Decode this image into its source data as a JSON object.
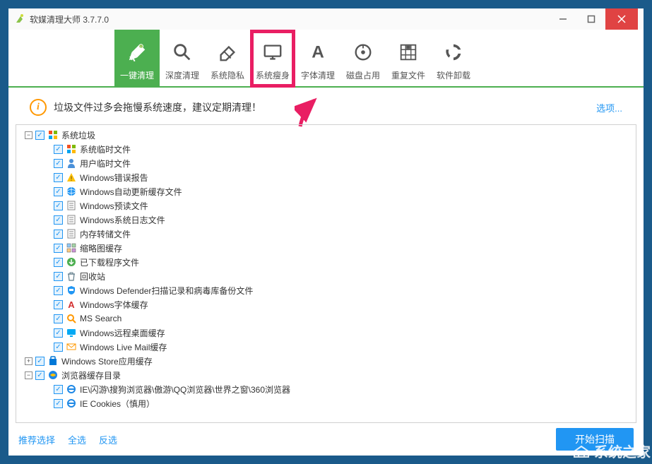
{
  "titlebar": {
    "title": "软媒清理大师 3.7.7.0"
  },
  "toolbar": {
    "items": [
      {
        "label": "一键清理",
        "icon": "brush",
        "active": true
      },
      {
        "label": "深度清理",
        "icon": "search"
      },
      {
        "label": "系统隐私",
        "icon": "eraser"
      },
      {
        "label": "系统瘦身",
        "icon": "monitor",
        "highlighted": true
      },
      {
        "label": "字体清理",
        "icon": "font"
      },
      {
        "label": "磁盘占用",
        "icon": "disk"
      },
      {
        "label": "重复文件",
        "icon": "grid"
      },
      {
        "label": "软件卸载",
        "icon": "recycle"
      }
    ]
  },
  "info": {
    "text": "垃圾文件过多会拖慢系统速度，建议定期清理！",
    "options_label": "选项..."
  },
  "tree": [
    {
      "depth": 0,
      "exp": "-",
      "icon": "win",
      "label": "系统垃圾"
    },
    {
      "depth": 1,
      "icon": "win",
      "label": "系统临时文件"
    },
    {
      "depth": 1,
      "icon": "user",
      "label": "用户临时文件"
    },
    {
      "depth": 1,
      "icon": "warn",
      "label": "Windows错误报告"
    },
    {
      "depth": 1,
      "icon": "globe",
      "label": "Windows自动更新缓存文件"
    },
    {
      "depth": 1,
      "icon": "doc",
      "label": "Windows预读文件"
    },
    {
      "depth": 1,
      "icon": "doc",
      "label": "Windows系统日志文件"
    },
    {
      "depth": 1,
      "icon": "doc",
      "label": "内存转储文件"
    },
    {
      "depth": 1,
      "icon": "thumb",
      "label": "缩略图缓存"
    },
    {
      "depth": 1,
      "icon": "download",
      "label": "已下载程序文件"
    },
    {
      "depth": 1,
      "icon": "bin",
      "label": "回收站"
    },
    {
      "depth": 1,
      "icon": "shield",
      "label": "Windows Defender扫描记录和病毒库备份文件"
    },
    {
      "depth": 1,
      "icon": "font",
      "label": "Windows字体缓存"
    },
    {
      "depth": 1,
      "icon": "search-y",
      "label": "MS Search"
    },
    {
      "depth": 1,
      "icon": "remote",
      "label": "Windows远程桌面缓存"
    },
    {
      "depth": 1,
      "icon": "mail",
      "label": "Windows Live Mail缓存"
    },
    {
      "depth": 0,
      "exp": "+",
      "icon": "store",
      "label": "Windows Store应用缓存"
    },
    {
      "depth": 0,
      "exp": "-",
      "icon": "ie",
      "label": "浏览器缓存目录"
    },
    {
      "depth": 1,
      "icon": "ie-small",
      "label": "IE\\闪游\\搜狗浏览器\\傲游\\QQ浏览器\\世界之窗\\360浏览器"
    },
    {
      "depth": 1,
      "icon": "ie-small",
      "label": "IE Cookies（慎用）"
    }
  ],
  "footer": {
    "recommend": "推荐选择",
    "select_all": "全选",
    "invert": "反选",
    "scan": "开始扫描"
  },
  "watermark": "系统之家"
}
